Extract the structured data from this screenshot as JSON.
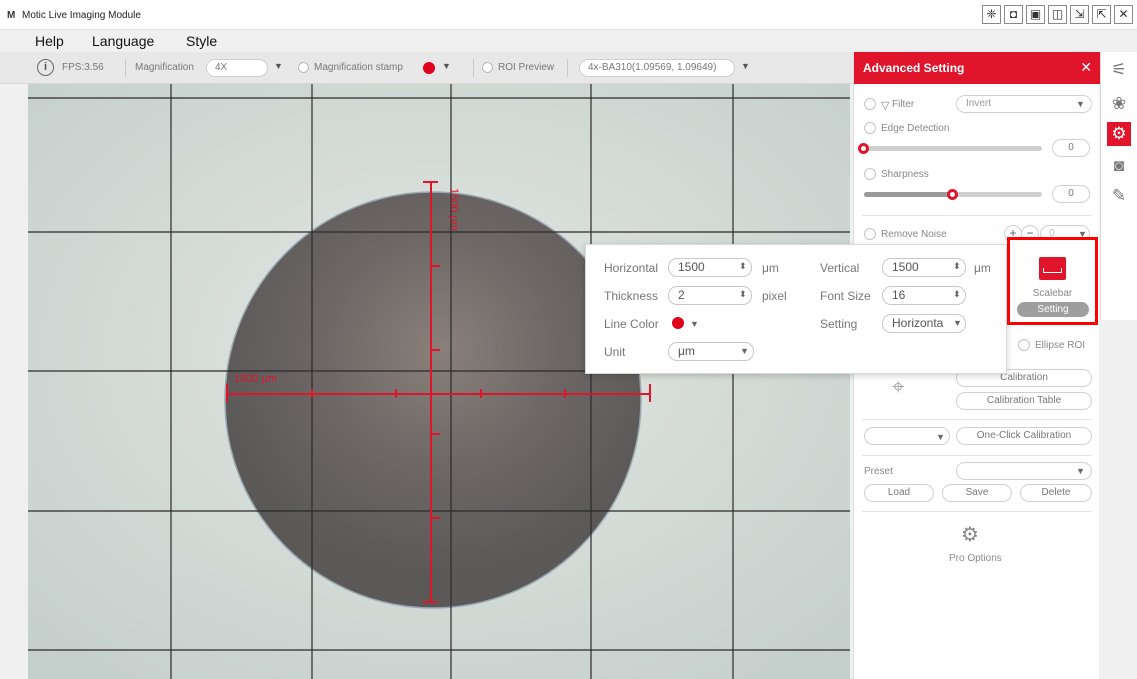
{
  "window": {
    "logo": "M",
    "title": "Motic Live Imaging Module",
    "controls": [
      "❈",
      "◘",
      "▣",
      "◫",
      "⇲",
      "⇱",
      "✕"
    ]
  },
  "menu": [
    "Help",
    "Language",
    "Style"
  ],
  "toolbar": {
    "fps": "FPS:3.56",
    "magnification_label": "Magnification",
    "magnification_value": "4X",
    "magnification_stamp_label": "Magnification stamp",
    "roi_preview_label": "ROI Preview",
    "calibration_value": "4x-BA310(1.09569, 1.09649)"
  },
  "viewport": {
    "horizontal_label": "1500 μm",
    "vertical_label": "1500 μm"
  },
  "panel": {
    "title": "Advanced Setting",
    "filter_label": "Filter",
    "filter_value": "Invert",
    "edge_label": "Edge Detection",
    "edge_value": "0",
    "edge_level": 0.0,
    "sharpness_label": "Sharpness",
    "sharpness_value": "0",
    "sharpness_level": 0.5,
    "noise_label": "Remove Noise",
    "noise_value": "0",
    "ellipse_label": "Ellipse ROI",
    "calibration_btn": "Calibration",
    "calibration_table_btn": "Calibration Table",
    "one_click_btn": "One-Click Calibration",
    "preset_label": "Preset",
    "load_btn": "Load",
    "save_btn": "Save",
    "delete_btn": "Delete",
    "pro_options_label": "Pro Options"
  },
  "scalebar": {
    "label": "Scalebar",
    "setting_btn": "Setting"
  },
  "popup": {
    "horizontal_label": "Horizontal",
    "horizontal_value": "1500",
    "horizontal_unit": "μm",
    "vertical_label": "Vertical",
    "vertical_value": "1500",
    "vertical_unit": "μm",
    "thickness_label": "Thickness",
    "thickness_value": "2",
    "thickness_unit": "pixel",
    "font_size_label": "Font Size",
    "font_size_value": "16",
    "line_color_label": "Line Color",
    "setting_label": "Setting",
    "setting_value": "Horizonta",
    "unit_label": "Unit",
    "unit_value": "μm"
  },
  "colors": {
    "accent": "#e0142b",
    "scalebar_line": "#e0142b",
    "highlight": "#ff0000"
  }
}
